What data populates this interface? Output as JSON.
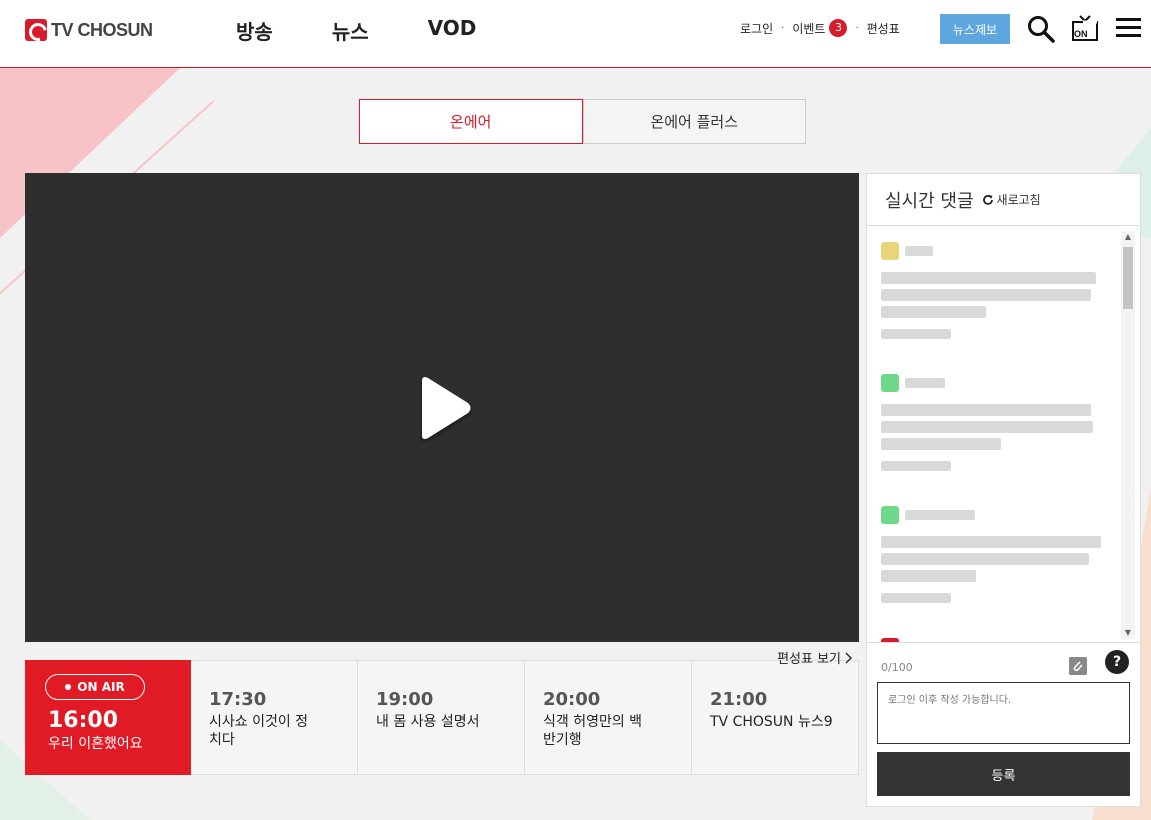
{
  "header": {
    "logo_text": "TV CHOSUN",
    "nav": [
      "방송",
      "뉴스",
      "VOD"
    ],
    "util": {
      "login": "로그인",
      "event": "이벤트",
      "event_count": "3",
      "schedule": "편성표"
    },
    "report_button": "뉴스제보",
    "icons": [
      "search-icon",
      "tv-on-icon",
      "menu-icon"
    ]
  },
  "tabs": [
    {
      "label": "온에어",
      "active": true
    },
    {
      "label": "온에어 플러스",
      "active": false
    }
  ],
  "player": {
    "background": "#2e2e2e",
    "icon": "play-icon"
  },
  "schedule": {
    "link_label": "편성표 보기",
    "now": {
      "badge": "ON AIR",
      "time": "16:00",
      "title": "우리 이혼했어요"
    },
    "upcoming": [
      {
        "time": "17:30",
        "title": "시사쇼 이것이 정치다"
      },
      {
        "time": "19:00",
        "title": "내 몸 사용 설명서"
      },
      {
        "time": "20:00",
        "title": "식객 허영만의 백반기행"
      },
      {
        "time": "21:00",
        "title": "TV CHOSUN 뉴스9"
      }
    ]
  },
  "comments": {
    "title": "실시간 댓글",
    "refresh_label": "새로고침",
    "counter": "0/100",
    "help_label": "?",
    "input_placeholder": "로그인 이후 작성 가능합니다.",
    "submit_label": "등록"
  },
  "colors": {
    "brand_red": "#e01b26",
    "report_blue": "#5ea7de",
    "dark": "#333333"
  }
}
